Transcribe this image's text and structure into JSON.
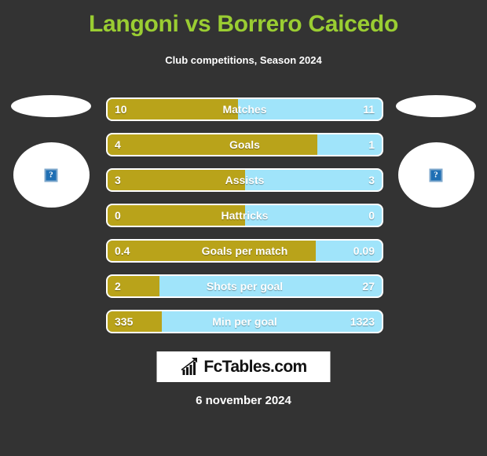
{
  "header": {
    "title": "Langoni vs Borrero Caicedo",
    "subtitle": "Club competitions, Season 2024",
    "title_color": "#9ACD32"
  },
  "players": {
    "home": {
      "photo_placeholder": "broken-image",
      "placeholder_glyph": "?"
    },
    "away": {
      "photo_placeholder": "broken-image",
      "placeholder_glyph": "?"
    }
  },
  "colors": {
    "background": "#333333",
    "home_bar": "#B9A31A",
    "away_bar": "#A0E4FA",
    "bar_border": "#FFFFFF",
    "text": "#FFFFFF"
  },
  "chart_data": {
    "type": "bar",
    "title": "Langoni vs Borrero Caicedo",
    "subtitle": "Club competitions, Season 2024",
    "orientation": "horizontal-diverging",
    "series": [
      {
        "name": "Langoni",
        "values": [
          10,
          4,
          3,
          0,
          0.4,
          2,
          335
        ]
      },
      {
        "name": "Borrero Caicedo",
        "values": [
          11,
          1,
          3,
          0,
          0.09,
          27,
          1323
        ]
      }
    ],
    "categories": [
      "Matches",
      "Goals",
      "Assists",
      "Hattricks",
      "Goals per match",
      "Shots per goal",
      "Min per goal"
    ],
    "xlabel": "",
    "ylabel": "",
    "legend": [
      "Langoni",
      "Borrero Caicedo"
    ]
  },
  "stats": [
    {
      "label": "Matches",
      "home": "10",
      "away": "11",
      "fill_pct": 47.6
    },
    {
      "label": "Goals",
      "home": "4",
      "away": "1",
      "fill_pct": 76.5
    },
    {
      "label": "Assists",
      "home": "3",
      "away": "3",
      "fill_pct": 50.0
    },
    {
      "label": "Hattricks",
      "home": "0",
      "away": "0",
      "fill_pct": 50.0
    },
    {
      "label": "Goals per match",
      "home": "0.4",
      "away": "0.09",
      "fill_pct": 76.0
    },
    {
      "label": "Shots per goal",
      "home": "2",
      "away": "27",
      "fill_pct": 19.0
    },
    {
      "label": "Min per goal",
      "home": "335",
      "away": "1323",
      "fill_pct": 19.8
    }
  ],
  "footer": {
    "logo_text": "FcTables.com",
    "logo_icon": "bar-chart-arrow-icon",
    "date": "6 november 2024"
  }
}
